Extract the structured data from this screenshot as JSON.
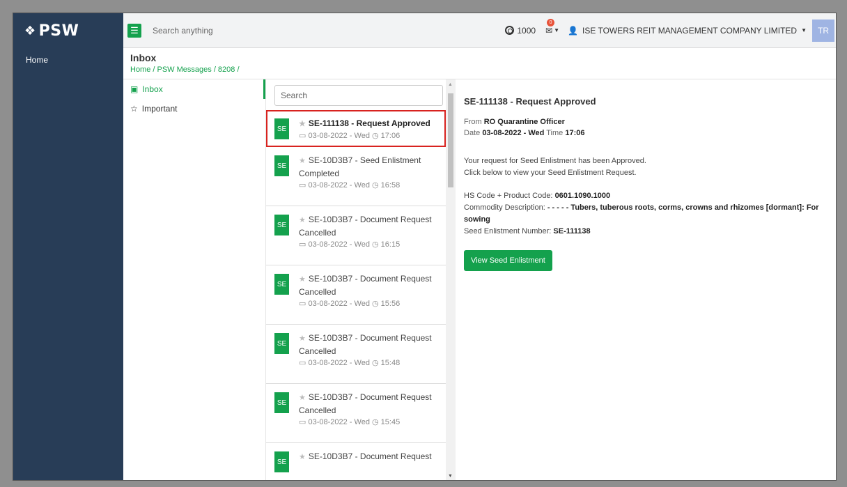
{
  "sidebar": {
    "logo": "PSW",
    "items": [
      {
        "label": "Home"
      }
    ]
  },
  "topbar": {
    "search_placeholder": "Search anything",
    "coins": "1000",
    "mail_badge": "0",
    "company": "ISE TOWERS REIT MANAGEMENT COMPANY LIMITED",
    "avatar": "TR"
  },
  "header": {
    "title": "Inbox",
    "breadcrumb": "Home / PSW Messages / 8208 /"
  },
  "folders": [
    {
      "label": "Inbox",
      "icon": "inbox-icon"
    },
    {
      "label": "Important",
      "icon": "star-icon"
    }
  ],
  "list": {
    "search_placeholder": "Search",
    "messages": [
      {
        "badge": "SE",
        "subject": "SE-111138 - Request Approved",
        "date": "03-08-2022 - Wed",
        "time": "17:06"
      },
      {
        "badge": "SE",
        "subject": "SE-10D3B7 - Seed Enlistment Completed",
        "date": "03-08-2022 - Wed",
        "time": "16:58"
      },
      {
        "badge": "SE",
        "subject": "SE-10D3B7 - Document Request Cancelled",
        "date": "03-08-2022 - Wed",
        "time": "16:15"
      },
      {
        "badge": "SE",
        "subject": "SE-10D3B7 - Document Request Cancelled",
        "date": "03-08-2022 - Wed",
        "time": "15:56"
      },
      {
        "badge": "SE",
        "subject": "SE-10D3B7 - Document Request Cancelled",
        "date": "03-08-2022 - Wed",
        "time": "15:48"
      },
      {
        "badge": "SE",
        "subject": "SE-10D3B7 - Document Request Cancelled",
        "date": "03-08-2022 - Wed",
        "time": "15:45"
      },
      {
        "badge": "SE",
        "subject": "SE-10D3B7 - Document Request",
        "date": "",
        "time": ""
      }
    ]
  },
  "detail": {
    "subject": "SE-111138 - Request Approved",
    "from_label": "From",
    "from": "RO Quarantine Officer",
    "date_label": "Date",
    "date": "03-08-2022 - Wed",
    "time_label": "Time",
    "time": "17:06",
    "line1": "Your request for Seed Enlistment has been Approved.",
    "line2": "Click below to view your Seed Enlistment Request.",
    "hs_label": "HS Code + Product Code:",
    "hs_value": "0601.1090.1000",
    "commodity_label": "Commodity Description:",
    "commodity_value": "- - - - - Tubers, tuberous roots, corms, crowns and rhizomes [dormant]: For sowing",
    "enlist_label": "Seed Enlistment Number:",
    "enlist_value": "SE-111138",
    "button": "View Seed Enlistment"
  },
  "colors": {
    "brand_green": "#14a14d",
    "sidebar": "#283d57",
    "highlight": "#d8231f"
  }
}
